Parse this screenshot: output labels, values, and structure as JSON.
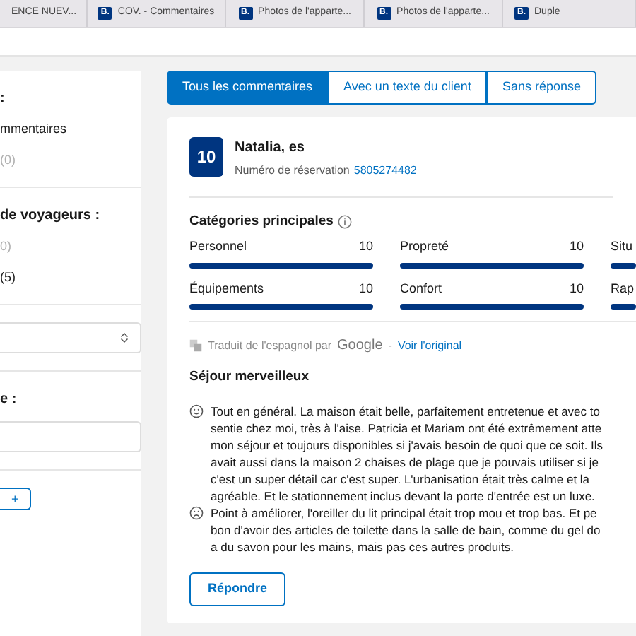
{
  "browser_tabs": [
    {
      "title": "ENCE NUEV..."
    },
    {
      "icon_text": "B.",
      "title": "COV. - Commentaires"
    },
    {
      "icon_text": "B.",
      "title": "Photos de l'apparte..."
    },
    {
      "icon_text": "B.",
      "title": "Photos de l'apparte..."
    },
    {
      "icon_text": "B.",
      "title": "Duple"
    }
  ],
  "sidebar": {
    "sections": [
      {
        "items": [
          {
            "text": ":",
            "kind": "heading"
          },
          {
            "text": "mmentaires",
            "kind": "option"
          },
          {
            "text": "(0)",
            "kind": "muted"
          }
        ]
      },
      {
        "items": [
          {
            "text": "de voyageurs :",
            "kind": "heading"
          },
          {
            "text": "0)",
            "kind": "muted"
          },
          {
            "text": "(5)",
            "kind": "option"
          }
        ]
      },
      {
        "items": [
          {
            "kind": "select"
          }
        ]
      },
      {
        "items": [
          {
            "text": "e :",
            "kind": "heading"
          },
          {
            "kind": "input"
          }
        ]
      },
      {
        "items": [
          {
            "text": "+",
            "kind": "button"
          }
        ]
      }
    ]
  },
  "filter_tabs": [
    {
      "label": "Tous les commentaires",
      "selected": true
    },
    {
      "label": "Avec un texte du client",
      "selected": false
    },
    {
      "label": "Sans réponse",
      "selected": false
    }
  ],
  "review": {
    "score": "10",
    "guest": "Natalia, es",
    "booking_label": "Numéro de réservation",
    "booking_number": "5805274482",
    "categories_title": "Catégories principales",
    "categories": [
      {
        "label": "Personnel",
        "score": "10",
        "level": 1
      },
      {
        "label": "Propreté",
        "score": "10",
        "level": 1
      },
      {
        "label": "Situ",
        "level": 1
      },
      {
        "label": "Équipements",
        "score": "10",
        "level": 1
      },
      {
        "label": "Confort",
        "score": "10",
        "level": 1
      },
      {
        "label": "Rap",
        "level": 1
      }
    ],
    "translation": {
      "prefix": "Traduit de l'espagnol par",
      "provider": "Google",
      "separator": "-",
      "link": "Voir l'original"
    },
    "title": "Séjour merveilleux",
    "comments": [
      {
        "kind": "positive",
        "lines": [
          "Tout en général. La maison était belle, parfaitement entretenue et avec to",
          "sentie chez moi, très à l'aise. Patricia et Mariam ont été extrêmement atte",
          "mon séjour et toujours disponibles si j'avais besoin de quoi que ce soit. Ils",
          "avait aussi dans la maison 2 chaises de plage que je pouvais utiliser si je",
          "c'est un super détail car c'est super. L'urbanisation était très calme et la",
          "agréable. Et le stationnement inclus devant la porte d'entrée est un luxe."
        ]
      },
      {
        "kind": "negative",
        "lines": [
          "Point à améliorer, l'oreiller du lit principal était trop mou et trop bas. Et pe",
          "bon d'avoir des articles de toilette dans la salle de bain, comme du gel do",
          "a du savon pour les mains, mais pas ces autres produits."
        ]
      }
    ],
    "reply_button": "Répondre"
  }
}
